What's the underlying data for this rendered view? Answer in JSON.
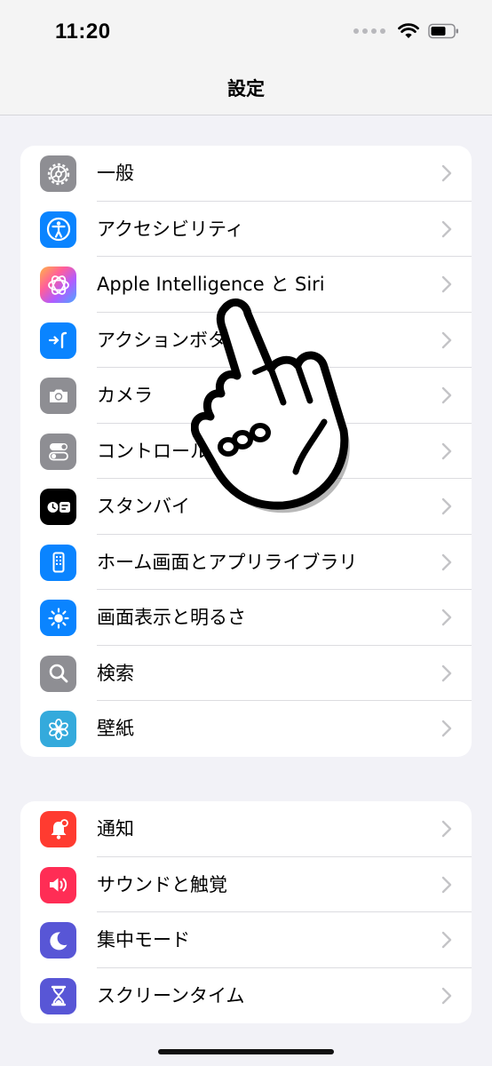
{
  "status_bar": {
    "time": "11:20"
  },
  "header": {
    "title": "設定"
  },
  "groups": [
    {
      "items": [
        {
          "label": "一般",
          "icon": "gear-icon",
          "color": "#8e8e93"
        },
        {
          "label": "アクセシビリティ",
          "icon": "accessibility-icon",
          "color": "#0a84ff"
        },
        {
          "label": "Apple Intelligence と Siri",
          "icon": "apple-intelligence-icon",
          "color": "gradient"
        },
        {
          "label": "アクションボタン",
          "icon": "action-button-icon",
          "color": "#0a84ff"
        },
        {
          "label": "カメラ",
          "icon": "camera-icon",
          "color": "#8e8e93"
        },
        {
          "label": "コントロールセンター",
          "icon": "control-center-icon",
          "color": "#8e8e93"
        },
        {
          "label": "スタンバイ",
          "icon": "standby-icon",
          "color": "#000000"
        },
        {
          "label": "ホーム画面とアプリライブラリ",
          "icon": "home-screen-icon",
          "color": "#0a84ff"
        },
        {
          "label": "画面表示と明るさ",
          "icon": "brightness-icon",
          "color": "#0a84ff"
        },
        {
          "label": "検索",
          "icon": "search-icon",
          "color": "#8e8e93"
        },
        {
          "label": "壁紙",
          "icon": "wallpaper-icon",
          "color": "#34aadc"
        }
      ]
    },
    {
      "items": [
        {
          "label": "通知",
          "icon": "notification-bell-icon",
          "color": "#ff3b30"
        },
        {
          "label": "サウンドと触覚",
          "icon": "speaker-icon",
          "color": "#ff2d55"
        },
        {
          "label": "集中モード",
          "icon": "moon-icon",
          "color": "#5856d6"
        },
        {
          "label": "スクリーンタイム",
          "icon": "hourglass-icon",
          "color": "#5856d6"
        }
      ]
    }
  ]
}
